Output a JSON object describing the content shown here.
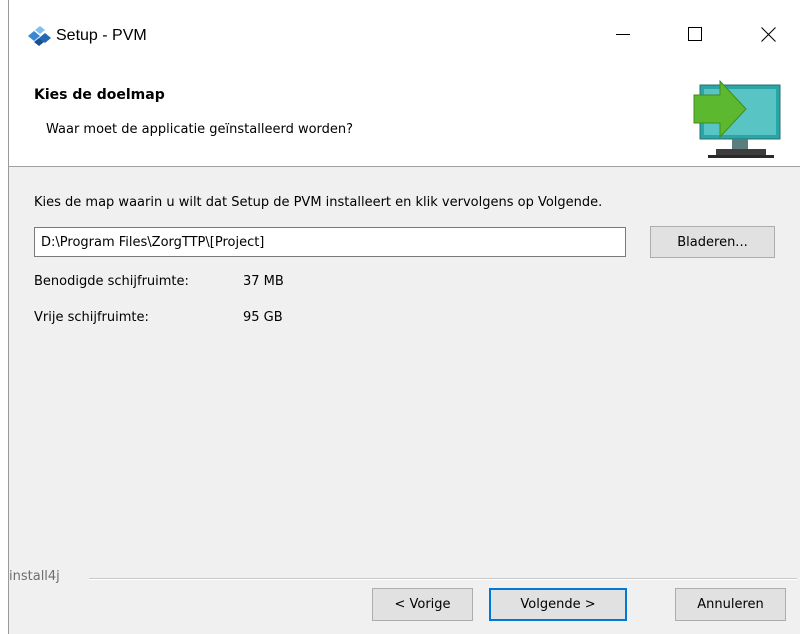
{
  "window": {
    "title": "Setup - PVM"
  },
  "header": {
    "title": "Kies de doelmap",
    "subtitle": "Waar moet de applicatie geïnstalleerd worden?"
  },
  "content": {
    "instruction": "Kies de map waarin u wilt dat Setup de PVM installeert en klik vervolgens op Volgende.",
    "path_value": "D:\\Program Files\\ZorgTTP\\[Project]",
    "browse_label": "Bladeren...",
    "required_space_label": "Benodigde schijfruimte:",
    "required_space_value": "37 MB",
    "free_space_label": "Vrije schijfruimte:",
    "free_space_value": "95 GB"
  },
  "footer": {
    "brand": "install4j",
    "back_label": "< Vorige",
    "next_label": "Volgende >",
    "cancel_label": "Annuleren"
  },
  "colors": {
    "focus_border": "#0078d7",
    "arrow_green": "#5cb82e",
    "monitor_teal": "#2aa6a6"
  },
  "icons": {
    "app": "pvm-app-icon",
    "header": "install-to-computer-icon",
    "minimize": "minimize-icon",
    "maximize": "maximize-icon",
    "close": "close-icon"
  }
}
